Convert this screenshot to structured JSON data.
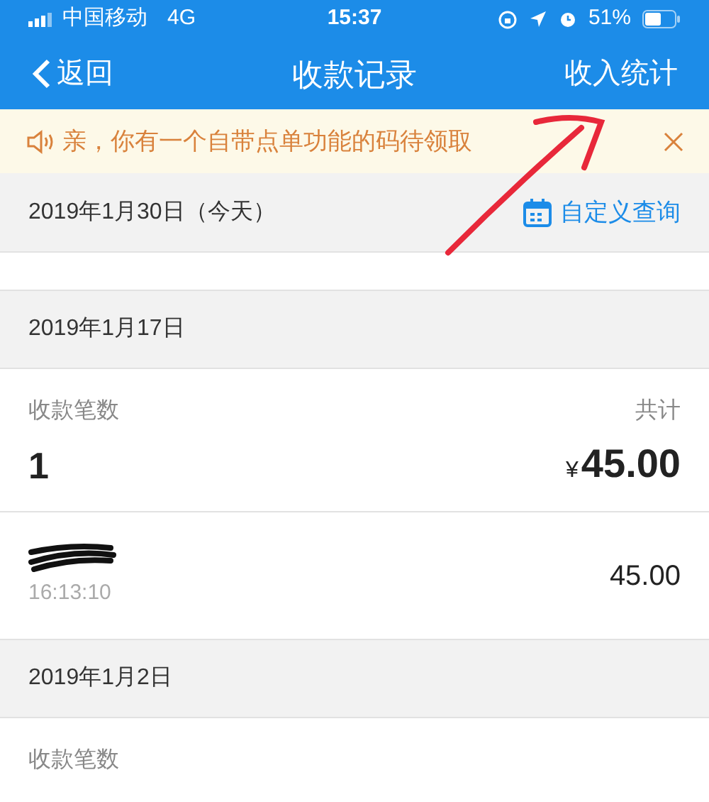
{
  "status_bar": {
    "carrier": "中国移动",
    "network": "4G",
    "time": "15:37",
    "battery": "51%"
  },
  "nav": {
    "back": "返回",
    "title": "收款记录",
    "action": "收入统计"
  },
  "notice": {
    "text": "亲，你有一个自带点单功能的码待领取"
  },
  "sections": [
    {
      "date": "2019年1月30日（今天）",
      "query": "自定义查询",
      "empty": true
    },
    {
      "date": "2019年1月17日",
      "summary": {
        "count_label": "收款笔数",
        "count": "1",
        "total_label": "共计",
        "currency": "¥",
        "total": "45.00"
      },
      "transactions": [
        {
          "time": "16:13:10",
          "amount": "45.00"
        }
      ]
    },
    {
      "date": "2019年1月2日",
      "summary": {
        "count_label": "收款笔数"
      }
    }
  ]
}
